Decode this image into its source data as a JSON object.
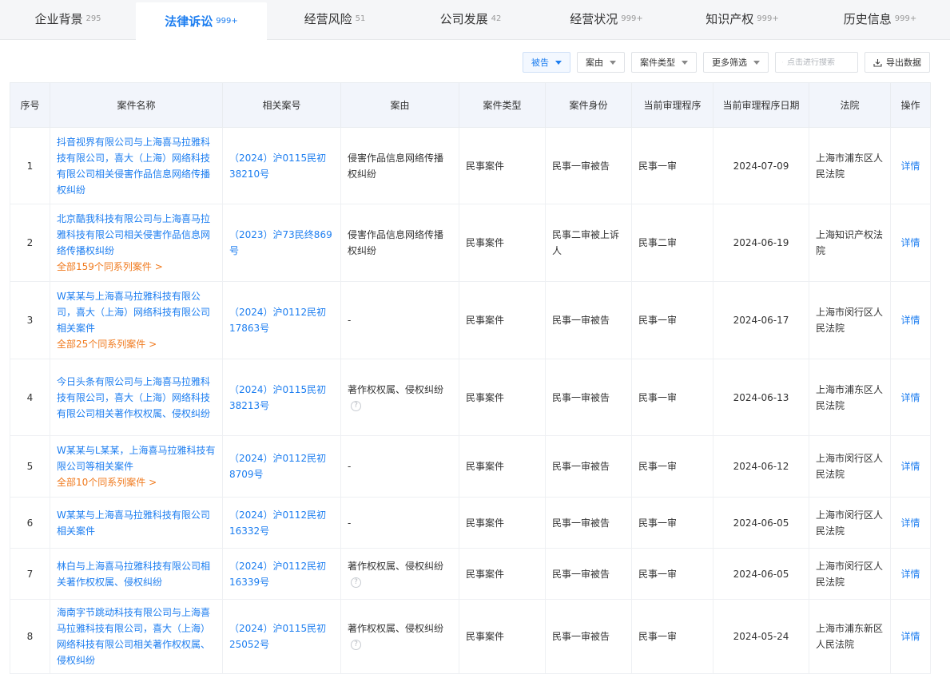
{
  "tabs": [
    {
      "label": "企业背景",
      "count": "295",
      "active": false
    },
    {
      "label": "法律诉讼",
      "count": "999+",
      "active": true
    },
    {
      "label": "经营风险",
      "count": "51",
      "active": false
    },
    {
      "label": "公司发展",
      "count": "42",
      "active": false
    },
    {
      "label": "经营状况",
      "count": "999+",
      "active": false
    },
    {
      "label": "知识产权",
      "count": "999+",
      "active": false
    },
    {
      "label": "历史信息",
      "count": "999+",
      "active": false
    }
  ],
  "toolbar": {
    "filter_role": "被告",
    "filter_cause": "案由",
    "filter_type": "案件类型",
    "filter_more": "更多筛选",
    "search_placeholder": "点击进行搜索",
    "export_label": "导出数据"
  },
  "table": {
    "headers": [
      "序号",
      "案件名称",
      "相关案号",
      "案由",
      "案件类型",
      "案件身份",
      "当前审理程序",
      "当前审理程序日期",
      "法院",
      "操作"
    ],
    "rows": [
      {
        "idx": "1",
        "name": "抖音视界有限公司与上海喜马拉雅科技有限公司，喜大（上海）网络科技有限公司相关侵害作品信息网络传播权纠纷",
        "series": "",
        "case_no": "（2024）沪0115民初38210号",
        "cause": "侵害作品信息网络传播权纠纷",
        "cause_help": false,
        "type": "民事案件",
        "role": "民事一审被告",
        "procedure": "民事一审",
        "date": "2024-07-09",
        "court": "上海市浦东区人民法院",
        "action": "详情"
      },
      {
        "idx": "2",
        "name": "北京酷我科技有限公司与上海喜马拉雅科技有限公司相关侵害作品信息网络传播权纠纷",
        "series": "全部159个同系列案件 >",
        "case_no": "（2023）沪73民终869号",
        "cause": "侵害作品信息网络传播权纠纷",
        "cause_help": false,
        "type": "民事案件",
        "role": "民事二审被上诉人",
        "procedure": "民事二审",
        "date": "2024-06-19",
        "court": "上海知识产权法院",
        "action": "详情"
      },
      {
        "idx": "3",
        "name": "W某某与上海喜马拉雅科技有限公司，喜大（上海）网络科技有限公司相关案件",
        "series": "全部25个同系列案件 >",
        "case_no": "（2024）沪0112民初17863号",
        "cause": "-",
        "cause_help": false,
        "type": "民事案件",
        "role": "民事一审被告",
        "procedure": "民事一审",
        "date": "2024-06-17",
        "court": "上海市闵行区人民法院",
        "action": "详情"
      },
      {
        "idx": "4",
        "name": "今日头条有限公司与上海喜马拉雅科技有限公司，喜大（上海）网络科技有限公司相关著作权权属、侵权纠纷",
        "series": "",
        "case_no": "（2024）沪0115民初38213号",
        "cause": "著作权权属、侵权纠纷",
        "cause_help": true,
        "type": "民事案件",
        "role": "民事一审被告",
        "procedure": "民事一审",
        "date": "2024-06-13",
        "court": "上海市浦东区人民法院",
        "action": "详情"
      },
      {
        "idx": "5",
        "name": "W某某与L某某，上海喜马拉雅科技有限公司等相关案件",
        "series": "全部10个同系列案件 >",
        "case_no": "（2024）沪0112民初8709号",
        "cause": "-",
        "cause_help": false,
        "type": "民事案件",
        "role": "民事一审被告",
        "procedure": "民事一审",
        "date": "2024-06-12",
        "court": "上海市闵行区人民法院",
        "action": "详情"
      },
      {
        "idx": "6",
        "name": "W某某与上海喜马拉雅科技有限公司相关案件",
        "series": "",
        "case_no": "（2024）沪0112民初16332号",
        "cause": "-",
        "cause_help": false,
        "type": "民事案件",
        "role": "民事一审被告",
        "procedure": "民事一审",
        "date": "2024-06-05",
        "court": "上海市闵行区人民法院",
        "action": "详情"
      },
      {
        "idx": "7",
        "name": "林白与上海喜马拉雅科技有限公司相关著作权权属、侵权纠纷",
        "series": "",
        "case_no": "（2024）沪0112民初16339号",
        "cause": "著作权权属、侵权纠纷",
        "cause_help": true,
        "type": "民事案件",
        "role": "民事一审被告",
        "procedure": "民事一审",
        "date": "2024-06-05",
        "court": "上海市闵行区人民法院",
        "action": "详情"
      },
      {
        "idx": "8",
        "name": "海南字节跳动科技有限公司与上海喜马拉雅科技有限公司，喜大（上海）网络科技有限公司相关著作权权属、侵权纠纷",
        "series": "",
        "case_no": "（2024）沪0115民初25052号",
        "cause": "著作权权属、侵权纠纷",
        "cause_help": true,
        "type": "民事案件",
        "role": "民事一审被告",
        "procedure": "民事一审",
        "date": "2024-05-24",
        "court": "上海市浦东新区人民法院",
        "action": "详情"
      }
    ]
  }
}
